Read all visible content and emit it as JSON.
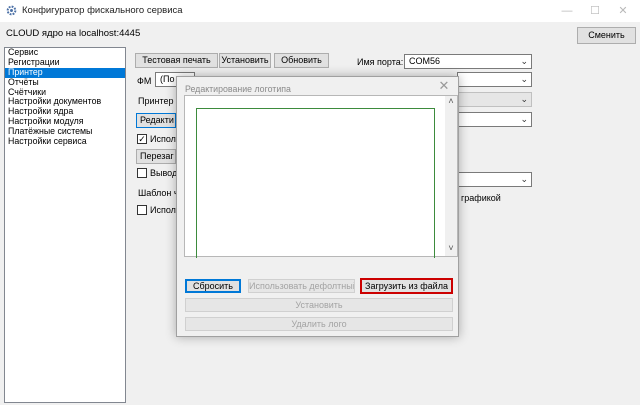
{
  "window": {
    "title": "Конфигуратор фискального сервиса",
    "minimize_glyph": "—",
    "maximize_glyph": "☐",
    "close_glyph": "✕",
    "icon": "gear-icon"
  },
  "server": {
    "label": "CLOUD ядро на localhost:4445",
    "change_button": "Сменить"
  },
  "sidebar": {
    "items": [
      {
        "label": "Сервис",
        "selected": false
      },
      {
        "label": "Регистрации",
        "selected": false
      },
      {
        "label": "Принтер",
        "selected": true
      },
      {
        "label": "Отчёты",
        "selected": false
      },
      {
        "label": "Счётчики",
        "selected": false
      },
      {
        "label": "Настройки документов",
        "selected": false
      },
      {
        "label": "Настройки ядра",
        "selected": false
      },
      {
        "label": "Настройки модуля",
        "selected": false
      },
      {
        "label": "Платёжные системы",
        "selected": false
      },
      {
        "label": "Настройки сервиса",
        "selected": false
      }
    ]
  },
  "printer": {
    "test_print_button": "Тестовая печать",
    "install_button": "Установить",
    "refresh_button": "Обновить",
    "port_label": "Имя порта:",
    "port_value": "COM56",
    "fm_label": "ФМ",
    "fm_value": "(По у",
    "printer_label": "Принтер",
    "edit_button": "Редакти",
    "use_checkbox_label": "Исполь",
    "use_checked": true,
    "reload_button": "Перезаг",
    "output_checkbox_label": "Вывод",
    "output_checked": false,
    "template_label": "Шаблон ч",
    "use2_checkbox_label": "Исполь",
    "use2_checked": false,
    "graphics_label": "графикой"
  },
  "dialog": {
    "title": "Редактирование логотипа",
    "close_glyph": "✕",
    "scroll_up_glyph": "˄",
    "scroll_down_glyph": "˅",
    "reset_button": "Сбросить",
    "default_button": "Использовать дефолтный",
    "load_file_button": "Загрузить из файла",
    "install_button": "Установить",
    "delete_button": "Удалить лого",
    "highlight_color": "#cc0000",
    "logo_border_color": "#3d8b3d"
  }
}
